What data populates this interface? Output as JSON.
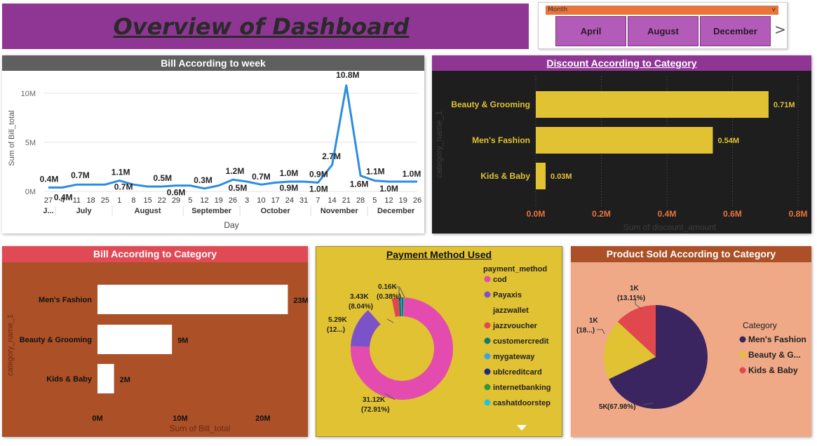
{
  "dashboard": {
    "title": "Overview of Dashboard"
  },
  "slicer": {
    "label": "Month",
    "options": [
      "April",
      "August",
      "December"
    ],
    "chevron": "v",
    "next": ">"
  },
  "colors": {
    "purple": "#8f3695",
    "slicer_orange": "#e8743b",
    "gold": "#e1c232",
    "rust": "#ac5027",
    "salmon": "#f0a987",
    "line_blue": "#2b8de2",
    "discount_bg": "#1e1e1e"
  },
  "week_chart": {
    "title": "Bill According to week",
    "ylabel": "Sum of Bill_total",
    "xlabel": "Day",
    "yticks": [
      "10M",
      "5M",
      "0M"
    ],
    "days": [
      "27",
      "4",
      "11",
      "18",
      "25",
      "1",
      "8",
      "15",
      "22",
      "29",
      "5",
      "12",
      "19",
      "26",
      "3",
      "10",
      "17",
      "24",
      "31",
      "7",
      "14",
      "21",
      "28",
      "5",
      "12",
      "19",
      "26"
    ],
    "months": [
      "J...",
      "July",
      "August",
      "September",
      "October",
      "November",
      "December"
    ],
    "data_labels": [
      "0.4M",
      "0.4M",
      "0.7M",
      "1.1M",
      "0.7M",
      "0.5M",
      "0.6M",
      "0.3M",
      "1.2M",
      "0.5M",
      "0.7M",
      "1.0M",
      "0.9M",
      "0.9M",
      "1.0M",
      "2.7M",
      "10.8M",
      "1.1M",
      "1.6M",
      "1.0M",
      "1.0M"
    ]
  },
  "discount_chart": {
    "title": "Discount According to Category",
    "ylabel": "category_name_1",
    "xlabel": "Sum of discount_amount",
    "xticks": [
      "0.0M",
      "0.2M",
      "0.4M",
      "0.6M",
      "0.8M"
    ]
  },
  "bill_cat_chart": {
    "title": "Bill According to Category",
    "ylabel": "category_name_1",
    "xlabel": "Sum of Bill_total",
    "xticks": [
      "0M",
      "10M",
      "20M"
    ]
  },
  "payment_chart": {
    "title": "Payment Method Used",
    "legend_title": "payment_method",
    "labels": [
      {
        "value": "0.16K",
        "pct": "(0.38%)"
      },
      {
        "value": "3.43K",
        "pct": "(8.04%)"
      },
      {
        "value": "5.29K",
        "pct": "(12...)"
      },
      {
        "value": "31.12K",
        "pct": "(72.91%)"
      }
    ]
  },
  "product_chart": {
    "title": "Product Sold According to Category",
    "legend_title": "Category",
    "legend_items": [
      "Men's Fashion",
      "Beauty & G...",
      "Kids & Baby"
    ],
    "labels": [
      {
        "value": "1K",
        "pct": "(13.11%)"
      },
      {
        "value": "1K",
        "pct": "(18...)"
      },
      {
        "value": "5K",
        "pct": "(67.98%)"
      }
    ]
  },
  "chart_data": [
    {
      "type": "line",
      "title": "Bill According to week",
      "xlabel": "Day",
      "ylabel": "Sum of Bill_total",
      "ylim": [
        0,
        11000000
      ],
      "x": [
        "J... 27",
        "July 4",
        "July 11",
        "July 18",
        "July 25",
        "August 1",
        "August 8",
        "August 15",
        "August 22",
        "August 29",
        "September 5",
        "September 12",
        "September 19",
        "September 26",
        "October 3",
        "October 10",
        "October 17",
        "October 24",
        "October 31",
        "November 7",
        "November 14",
        "November 21",
        "November 28",
        "December 5",
        "December 12",
        "December 19",
        "December 26"
      ],
      "series": [
        {
          "values": [
            400000,
            400000,
            700000,
            700000,
            700000,
            1100000,
            700000,
            500000,
            500000,
            600000,
            600000,
            300000,
            600000,
            1200000,
            1000000,
            700000,
            900000,
            1000000,
            1000000,
            900000,
            2700000,
            10800000,
            1600000,
            1100000,
            1000000,
            1000000,
            1000000
          ]
        }
      ]
    },
    {
      "type": "bar",
      "orientation": "horizontal",
      "title": "Discount According to Category",
      "xlabel": "Sum of discount_amount",
      "ylabel": "category_name_1",
      "xlim": [
        0,
        800000
      ],
      "categories": [
        "Beauty & Grooming",
        "Men's Fashion",
        "Kids & Baby"
      ],
      "values": [
        710000,
        540000,
        30000
      ],
      "value_labels": [
        "0.71M",
        "0.54M",
        "0.03M"
      ],
      "bar_color": "#e1c232",
      "grid": true
    },
    {
      "type": "bar",
      "orientation": "horizontal",
      "title": "Bill According to Category",
      "xlabel": "Sum of Bill_total",
      "ylabel": "category_name_1",
      "xlim": [
        0,
        25000000
      ],
      "categories": [
        "Men's Fashion",
        "Beauty & Grooming",
        "Kids & Baby"
      ],
      "values": [
        23000000,
        9000000,
        2000000
      ],
      "value_labels": [
        "23M",
        "9M",
        "2M"
      ],
      "bar_color": "#ffffff"
    },
    {
      "type": "pie",
      "style": "donut",
      "title": "Payment Method Used",
      "legend_title": "payment_method",
      "categories": [
        "cod",
        "Payaxis",
        "jazzwallet",
        "jazzvoucher",
        "customercredit",
        "mygateway",
        "ublcreditcard",
        "internetbanking",
        "cashatdoorstep"
      ],
      "values": [
        31120,
        5290,
        3430,
        900,
        300,
        160,
        120,
        90,
        80
      ],
      "colors": [
        "#e44bae",
        "#7c52c8",
        "#e1c232",
        "#e0484e",
        "#127c6c",
        "#3aa4e6",
        "#1b2a86",
        "#2e9a3a",
        "#22c4dc"
      ],
      "legend_placement": "right"
    },
    {
      "type": "pie",
      "title": "Product Sold According to Category",
      "legend_title": "Category",
      "categories": [
        "Men's Fashion",
        "Beauty & G...",
        "Kids & Baby"
      ],
      "values": [
        67.98,
        18.91,
        13.11
      ],
      "colors": [
        "#3a2560",
        "#e1c232",
        "#e0484e"
      ],
      "legend_placement": "right"
    }
  ]
}
